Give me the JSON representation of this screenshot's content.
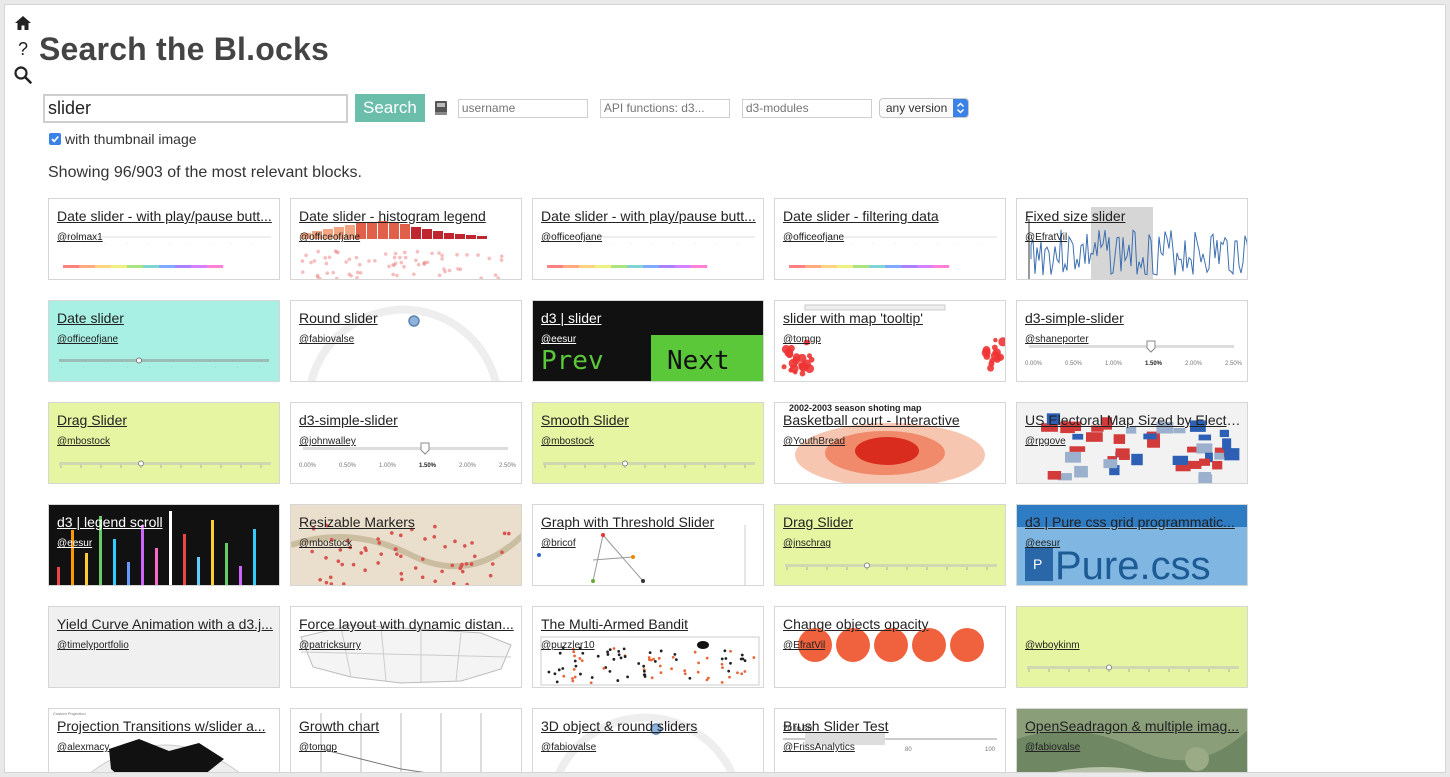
{
  "header": {
    "title": "Search the Bl.ocks",
    "side_icons": [
      "home-icon",
      "help-icon",
      "search-icon"
    ],
    "help_glyph": "?"
  },
  "search": {
    "query": "slider",
    "button_label": "Search",
    "username_placeholder": "username",
    "api_placeholder": "API functions: d3...",
    "modules_placeholder": "d3-modules",
    "version_label": "any version",
    "thumbnail_label": "with thumbnail image",
    "thumbnail_checked": true
  },
  "results_text": "Showing 96/903 of the most relevant blocks.",
  "colors": {
    "search_button": "#6bbdac",
    "select_accent": "#3b82e6",
    "card_border": "#d6d6d6"
  },
  "cards": [
    {
      "title": "Date slider - with play/pause butt...",
      "author": "@rolmax1",
      "thumb": "rainbow-dots"
    },
    {
      "title": "Date slider - histogram legend",
      "author": "@officeofjane",
      "thumb": "histogram"
    },
    {
      "title": "Date slider - with play/pause butt...",
      "author": "@officeofjane",
      "thumb": "rainbow-dots"
    },
    {
      "title": "Date slider - filtering data",
      "author": "@officeofjane",
      "thumb": "rainbow-dots"
    },
    {
      "title": "Fixed size slider",
      "author": "@EfratVil",
      "thumb": "signal"
    },
    {
      "title": "Date slider",
      "author": "@officeofjane",
      "thumb": "cyan-slider"
    },
    {
      "title": "Round slider",
      "author": "@fabiovalse",
      "thumb": "round"
    },
    {
      "title": "d3 | slider",
      "author": "@eesur",
      "thumb": "prev-next"
    },
    {
      "title": "slider with map 'tooltip'",
      "author": "@tomgp",
      "thumb": "map-tooltip"
    },
    {
      "title": "d3-simple-slider",
      "author": "@shaneporter",
      "thumb": "simple-slider"
    },
    {
      "title": "Drag Slider",
      "author": "@mbostock",
      "thumb": "lime-slider"
    },
    {
      "title": "d3-simple-slider",
      "author": "@johnwalley",
      "thumb": "simple-slider"
    },
    {
      "title": "Smooth Slider",
      "author": "@mbostock",
      "thumb": "lime-slider"
    },
    {
      "title": "Basketball court - Interactive",
      "author": "@YouthBread",
      "thumb": "basketball"
    },
    {
      "title": "US Electoral Map Sized by Electo...",
      "author": "@rpgove",
      "thumb": "electoral"
    },
    {
      "title": "d3 | legend scroll",
      "author": "@eesur",
      "thumb": "legend-scroll"
    },
    {
      "title": "Resizable Markers",
      "author": "@mbostock",
      "thumb": "markers"
    },
    {
      "title": "Graph with Threshold Slider",
      "author": "@bricof",
      "thumb": "graph"
    },
    {
      "title": "Drag Slider",
      "author": "@jnschrag",
      "thumb": "lime-slider"
    },
    {
      "title": "d3 | Pure css grid programmatic...",
      "author": "@eesur",
      "thumb": "purecss"
    },
    {
      "title": "Yield Curve Animation with a d3.j...",
      "author": "@timelyportfolio",
      "thumb": "gray"
    },
    {
      "title": "Force layout with dynamic distan...",
      "author": "@patricksurry",
      "thumb": "usmap"
    },
    {
      "title": "The Multi-Armed Bandit",
      "author": "@puzzler10",
      "thumb": "bandit"
    },
    {
      "title": "Change objects opacity",
      "author": "@EfratVil",
      "thumb": "circles"
    },
    {
      "title": "",
      "author": "@wboykinm",
      "thumb": "lime-slider"
    },
    {
      "title": "Projection Transitions w/slider a...",
      "author": "@alexmacy",
      "thumb": "projection"
    },
    {
      "title": "Growth chart",
      "author": "@tomgp",
      "thumb": "growth"
    },
    {
      "title": "3D object & round sliders",
      "author": "@fabiovalse",
      "thumb": "round"
    },
    {
      "title": "Brush Slider Test",
      "author": "@FrissAnalytics",
      "thumb": "brush"
    },
    {
      "title": "OpenSeadragon & multiple imag...",
      "author": "@fabiovalse",
      "thumb": "satellite"
    }
  ]
}
